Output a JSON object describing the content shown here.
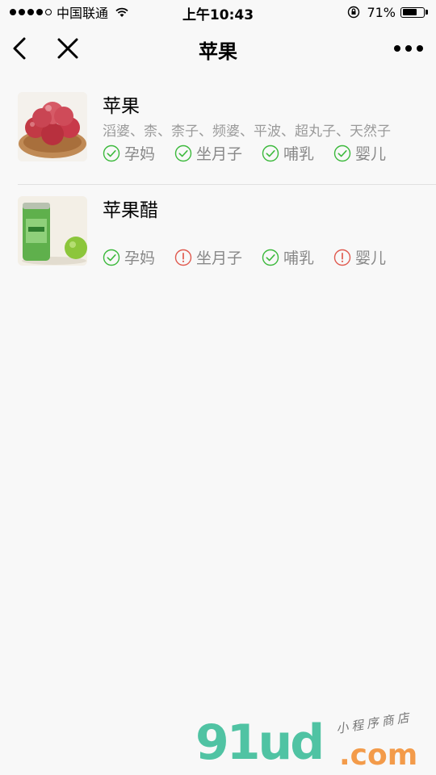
{
  "status_bar": {
    "carrier": "中国联通",
    "time": "上午10:43",
    "battery": "71%",
    "battery_level": 0.71
  },
  "nav": {
    "title": "苹果"
  },
  "items": [
    {
      "name": "苹果",
      "aliases": "滔婆、柰、柰子、频婆、平波、超丸子、天然子",
      "tags": [
        {
          "label": "孕妈",
          "status": "ok"
        },
        {
          "label": "坐月子",
          "status": "ok"
        },
        {
          "label": "哺乳",
          "status": "ok"
        },
        {
          "label": "婴儿",
          "status": "ok"
        }
      ]
    },
    {
      "name": "苹果醋",
      "aliases": "",
      "tags": [
        {
          "label": "孕妈",
          "status": "ok"
        },
        {
          "label": "坐月子",
          "status": "warn"
        },
        {
          "label": "哺乳",
          "status": "ok"
        },
        {
          "label": "婴儿",
          "status": "warn"
        }
      ]
    }
  ],
  "watermark": {
    "brand": "91ud",
    "domain": ".com",
    "tagline": "小程序商店"
  },
  "colors": {
    "ok": "#3cb93c",
    "warn": "#e05a4f"
  }
}
